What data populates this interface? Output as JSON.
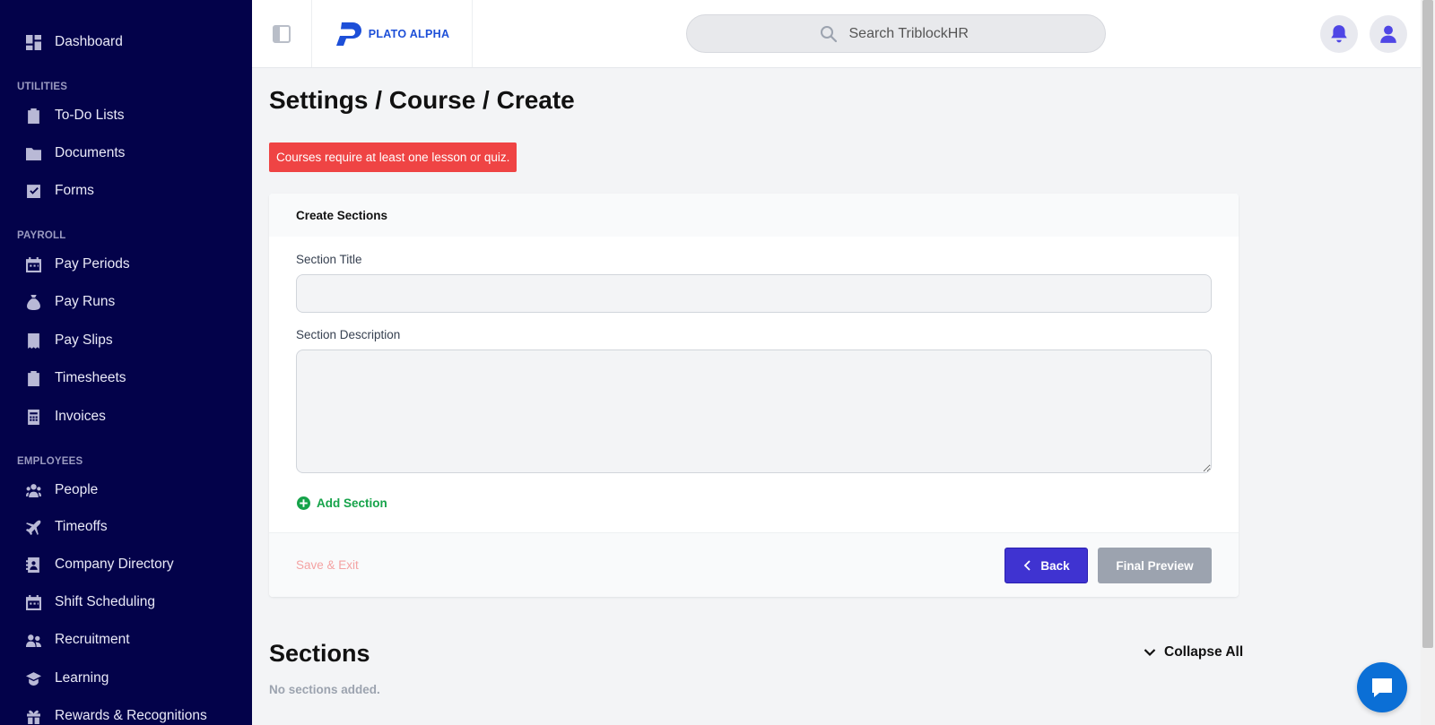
{
  "sidebar": {
    "items": [
      {
        "label": "Dashboard",
        "icon": "dashboard-icon"
      },
      {
        "label": "To-Do Lists",
        "icon": "clipboard-icon"
      },
      {
        "label": "Documents",
        "icon": "folder-icon"
      },
      {
        "label": "Forms",
        "icon": "checkbox-icon"
      },
      {
        "label": "Pay Periods",
        "icon": "calendar-icon"
      },
      {
        "label": "Pay Runs",
        "icon": "money-bag-icon"
      },
      {
        "label": "Pay Slips",
        "icon": "receipt-icon"
      },
      {
        "label": "Timesheets",
        "icon": "clipboard-list-icon"
      },
      {
        "label": "Invoices",
        "icon": "invoice-icon"
      },
      {
        "label": "People",
        "icon": "people-icon"
      },
      {
        "label": "Timeoffs",
        "icon": "plane-icon"
      },
      {
        "label": "Company Directory",
        "icon": "directory-icon"
      },
      {
        "label": "Shift Scheduling",
        "icon": "calendar-icon"
      },
      {
        "label": "Recruitment",
        "icon": "recruitment-icon"
      },
      {
        "label": "Learning",
        "icon": "graduation-cap-icon"
      },
      {
        "label": "Rewards & Recognitions",
        "icon": "gift-icon"
      }
    ],
    "sections": {
      "utilities": "UTILITIES",
      "payroll": "PAYROLL",
      "employees": "EMPLOYEES"
    }
  },
  "header": {
    "logo_text": "PLATO ALPHA",
    "search_placeholder": "Search TriblockHR"
  },
  "main": {
    "title": "Settings / Course / Create",
    "alert": "Courses require at least one lesson or quiz.",
    "card": {
      "heading": "Create Sections",
      "section_title_label": "Section Title",
      "section_title_value": "",
      "section_description_label": "Section Description",
      "section_description_value": "",
      "add_section": "Add Section",
      "save_exit": "Save & Exit",
      "back": "Back",
      "final_preview": "Final Preview"
    },
    "sections_heading": "Sections",
    "collapse_all": "Collapse All",
    "no_sections": "No sections added."
  },
  "colors": {
    "sidebar_bg": "#03024a",
    "primary": "#3f33d1",
    "alert": "#ef4444",
    "success": "#16a34a",
    "disabled": "#9ca3af"
  }
}
